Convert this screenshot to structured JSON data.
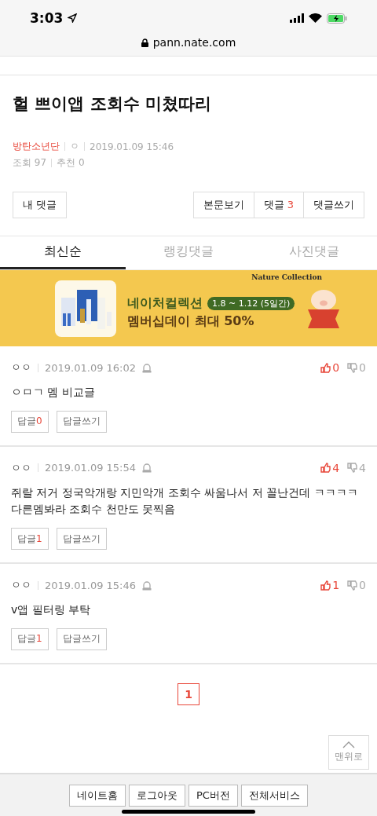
{
  "status_bar": {
    "time": "3:03"
  },
  "address_bar": {
    "url": "pann.nate.com"
  },
  "post": {
    "title": "헐 쁘이앱 조회수 미쳤따리",
    "author": "방탄소년단",
    "author_id": "ㅇ",
    "date": "2019.01.09 15:46",
    "views": "조회 97",
    "recommends": "추천 0"
  },
  "actions": {
    "my_comments": "내 댓글",
    "buttons": [
      {
        "label": "본문보기"
      },
      {
        "label": "댓글",
        "count": "3"
      },
      {
        "label": "댓글쓰기"
      }
    ]
  },
  "tabs": [
    {
      "label": "최신순",
      "selected": true
    },
    {
      "label": "랭킹댓글",
      "selected": false
    },
    {
      "label": "사진댓글",
      "selected": false
    }
  ],
  "banner": {
    "brand": "Nature Collection",
    "headline": "네이처컬렉션",
    "period": "1.8 ~ 1.12 (5일간)",
    "offer": "멤버십데이 최대 50%"
  },
  "comments": [
    {
      "author": "ㅇㅇ",
      "date": "2019.01.09 16:02",
      "text": "ㅇㅁㄱ 멤 비교글",
      "likes": "0",
      "dislikes": "0",
      "replies_label": "답글",
      "replies": "0",
      "write_reply": "답글쓰기"
    },
    {
      "author": "ㅇㅇ",
      "date": "2019.01.09 15:54",
      "text": "쥐랄 저거 정국악개랑 지민악개 조회수 싸움나서 저 꼴난건데 ㅋㅋㅋㅋ 다른멤봐라 조회수 천만도 못찍음",
      "likes": "4",
      "dislikes": "4",
      "replies_label": "답글",
      "replies": "1",
      "write_reply": "답글쓰기"
    },
    {
      "author": "ㅇㅇ",
      "date": "2019.01.09 15:46",
      "text": "v앱 필터링 부탁",
      "likes": "1",
      "dislikes": "0",
      "replies_label": "답글",
      "replies": "1",
      "write_reply": "답글쓰기"
    }
  ],
  "pagination": [
    {
      "label": "1",
      "selected": true
    }
  ],
  "top_button": "맨위로",
  "footer": [
    "네이트홈",
    "로그아웃",
    "PC버전",
    "전체서비스"
  ]
}
